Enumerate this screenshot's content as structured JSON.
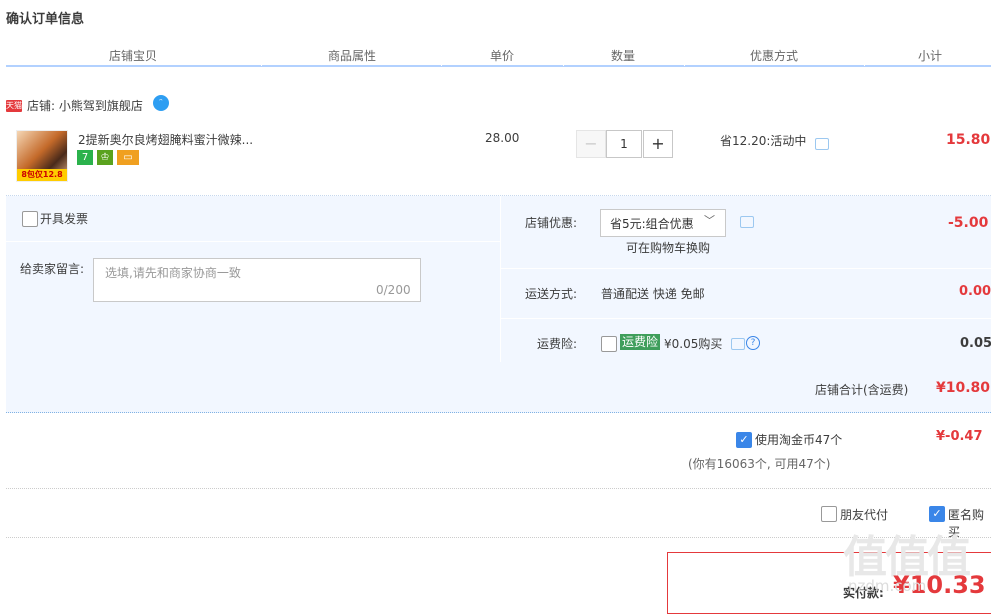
{
  "page_title": "确认订单信息",
  "table_headers": [
    "店铺宝贝",
    "商品属性",
    "单价",
    "数量",
    "优惠方式",
    "小计"
  ],
  "shop": {
    "badge": "天猫",
    "label": "店铺: 小熊驾到旗舰店",
    "chat_icon_glyph": "ᵔ"
  },
  "item": {
    "title": "2提新奥尔良烤翅腌料蜜汁微辣...",
    "thumb_tag": "8包仅12.8",
    "service_icons": [
      "7",
      "♔",
      "▭"
    ],
    "unit_price": "28.00",
    "quantity": "1",
    "minus": "−",
    "plus": "+",
    "promo": "省12.20:活动中",
    "subtotal": "15.80"
  },
  "options": {
    "invoice_label": "开具发票",
    "message_label": "给卖家留言:",
    "message_placeholder": "选填,请先和商家协商一致",
    "message_count": "0/200",
    "shop_discount_label": "店铺优惠:",
    "shop_discount_value": "省5元:组合优惠",
    "shop_discount_caret": "﹀",
    "shop_discount_note": "可在购物车换购",
    "shop_discount_amount": "-5.00",
    "shipping_label": "运送方式:",
    "shipping_value": "普通配送 快递 免邮",
    "shipping_amount": "0.00",
    "insurance_label": "运费险:",
    "insurance_badge": "运费险",
    "insurance_price": "¥0.05购买",
    "insurance_help": "?",
    "insurance_amount": "0.05"
  },
  "shop_total": {
    "label": "店铺合计(含运费)",
    "amount": "¥10.80"
  },
  "coins": {
    "checked_glyph": "✓",
    "label": "使用淘金币47个",
    "amount": "¥-0.47",
    "note": "(你有16063个, 可用47个)"
  },
  "purchase_options": {
    "friend_pay": "朋友代付",
    "anonymous": "匿名购买",
    "anonymous_checked_glyph": "✓"
  },
  "payment": {
    "label": "实付款:",
    "amount": "¥10.33"
  },
  "watermark": {
    "glyphs": "值值值",
    "url": "nzdm.com"
  },
  "colors": {
    "accent_red": "#e4393c",
    "header_rule": "#b2d1ff",
    "panel_bg": "#f2f7ff",
    "check_blue": "#3a86e8"
  }
}
